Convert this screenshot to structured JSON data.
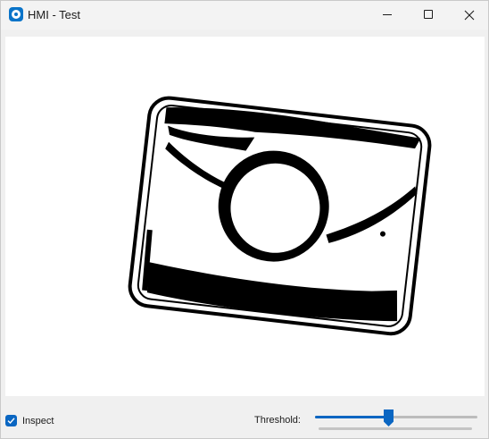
{
  "window": {
    "title": "HMI - Test",
    "app_icon": "camera-app-icon",
    "controls": [
      "minimize-icon",
      "maximize-icon",
      "close-icon"
    ]
  },
  "footer": {
    "inspect_label": "Inspect",
    "inspect_checked": true,
    "threshold_label": "Threshold:",
    "threshold_fraction": 0.45
  },
  "colors": {
    "accent": "#0a66c2",
    "window_bg": "#f0f0f0",
    "canvas_bg": "#ffffff",
    "image_fg": "#000000"
  }
}
